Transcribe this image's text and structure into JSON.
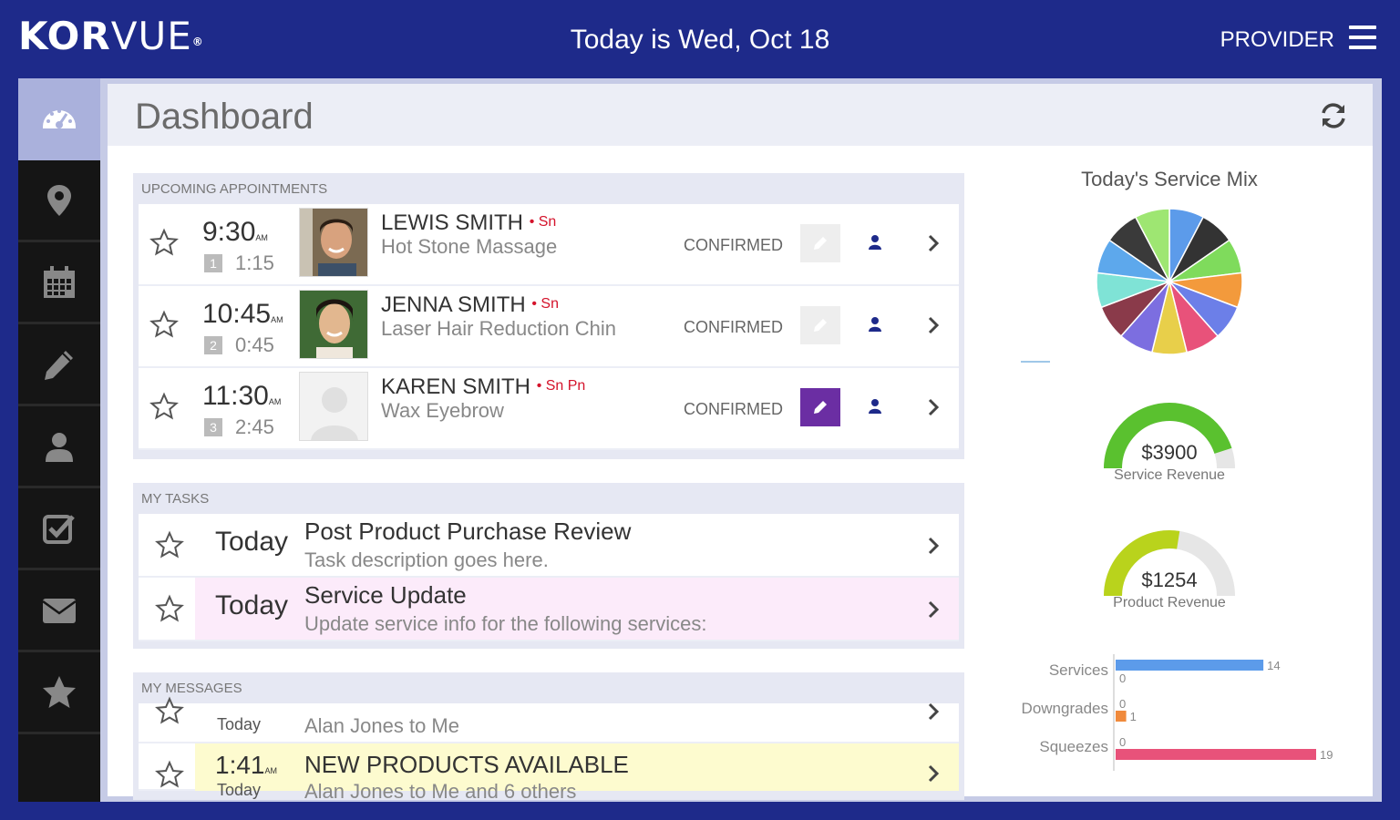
{
  "header": {
    "logo_bold": "KOR",
    "logo_light": "VUE",
    "logo_mark": "®",
    "date_text": "Today is Wed, Oct 18",
    "role": "PROVIDER"
  },
  "sidebar": {
    "items": [
      {
        "icon": "dashboard-icon",
        "active": true
      },
      {
        "icon": "location-pin-icon"
      },
      {
        "icon": "calendar-icon"
      },
      {
        "icon": "pencil-icon"
      },
      {
        "icon": "user-icon"
      },
      {
        "icon": "checkbox-icon"
      },
      {
        "icon": "envelope-icon"
      },
      {
        "icon": "star-icon"
      }
    ]
  },
  "page": {
    "title": "Dashboard"
  },
  "appointments": {
    "title": "UPCOMING APPOINTMENTS",
    "items": [
      {
        "num": "1",
        "time": "9:30",
        "ampm": "AM",
        "duration": "1:15",
        "name": "LEWIS SMITH",
        "tags": "• Sn",
        "service": "Hot Stone Massage",
        "status": "CONFIRMED",
        "edit_active": false
      },
      {
        "num": "2",
        "time": "10:45",
        "ampm": "AM",
        "duration": "0:45",
        "name": "JENNA SMITH",
        "tags": "• Sn",
        "service": "Laser Hair Reduction Chin",
        "status": "CONFIRMED",
        "edit_active": false
      },
      {
        "num": "3",
        "time": "11:30",
        "ampm": "AM",
        "duration": "2:45",
        "name": "KAREN SMITH",
        "tags": "• Sn Pn",
        "service": "Wax Eyebrow",
        "status": "CONFIRMED",
        "edit_active": true
      }
    ]
  },
  "tasks": {
    "title": "MY TASKS",
    "items": [
      {
        "when": "Today",
        "title": "Post Product Purchase Review",
        "desc": "Task description goes here."
      },
      {
        "when": "Today",
        "title": "Service Update",
        "desc": "Update service info for the following services:"
      }
    ]
  },
  "messages": {
    "title": "MY MESSAGES",
    "items": [
      {
        "when": "Today",
        "from": "Alan Jones to Me"
      },
      {
        "time": "1:41",
        "ampm": "AM",
        "when": "Today",
        "title": "NEW PRODUCTS AVAILABLE",
        "from": "Alan Jones to Me and 6 others"
      }
    ]
  },
  "service_mix": {
    "title": "Today's Service Mix",
    "slice_colors": [
      "#5c9bea",
      "#333333",
      "#7fdb5c",
      "#f39a3c",
      "#6c7fe8",
      "#e8527a",
      "#e8cf4a",
      "#7c6ee0",
      "#8a3a4a",
      "#7fe3d6",
      "#5da8ec",
      "#3a3a3a",
      "#9ee672"
    ]
  },
  "gauges": [
    {
      "value_text": "$3900",
      "label": "Service Revenue",
      "fraction": 0.9,
      "color": "#5ac12f"
    },
    {
      "value_text": "$1254",
      "label": "Product Revenue",
      "fraction": 0.55,
      "color": "#b9d31c"
    }
  ],
  "chart_data": {
    "type": "bar",
    "categories": [
      "Services",
      "Downgrades",
      "Squeezes"
    ],
    "series": [
      {
        "values": [
          14,
          0,
          0
        ],
        "color": "#5c9bea"
      },
      {
        "values": [
          0,
          1,
          19
        ],
        "color": "#f08a3c"
      }
    ],
    "value_labels": [
      "14",
      "0",
      "0",
      "1",
      "0",
      "19"
    ]
  }
}
